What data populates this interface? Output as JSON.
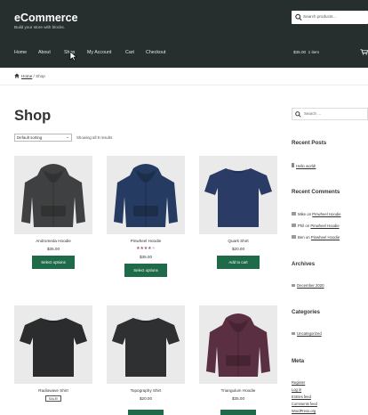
{
  "header": {
    "site_title": "eCommerce",
    "tagline": "Build your store with blocks.",
    "search_placeholder": "Search products…"
  },
  "nav": {
    "items": [
      {
        "label": "Home",
        "active": false
      },
      {
        "label": "About",
        "active": false
      },
      {
        "label": "Shop",
        "active": true
      },
      {
        "label": "My Account",
        "active": false
      },
      {
        "label": "Cart",
        "active": false
      },
      {
        "label": "Checkout",
        "active": false
      }
    ],
    "cart_total": "$35.00",
    "cart_count": "1 item"
  },
  "breadcrumb": {
    "home": "Home",
    "separator": "/",
    "current": "Shop"
  },
  "shop": {
    "title": "Shop",
    "sorting_value": "Default sorting",
    "results": "Showing all 9 results"
  },
  "products": [
    {
      "name": "Andromeda Hoodie",
      "price": "$35.00",
      "button": "Select options",
      "rating": null,
      "sale": false,
      "color": "#3f4041",
      "kind": "hoodie"
    },
    {
      "name": "Pinwheel Hoodie",
      "price": "$35.00",
      "button": "Select options",
      "rating": 4,
      "sale": false,
      "color": "#263b61",
      "kind": "hoodie"
    },
    {
      "name": "Quark Shirt",
      "price": "$20.00",
      "button": "Add to cart",
      "rating": null,
      "sale": false,
      "color": "#2a3b66",
      "kind": "shirt"
    },
    {
      "name": "Radiowave Shirt",
      "price": "$20.00",
      "button": "",
      "rating": null,
      "sale": true,
      "sale_label": "SALE!",
      "color": "#2b2c2d",
      "kind": "shirt"
    },
    {
      "name": "Topography Shirt",
      "price": "$20.00",
      "button": "",
      "rating": null,
      "sale": false,
      "color": "#2f3031",
      "kind": "shirt"
    },
    {
      "name": "Triangulum Hoodie",
      "price": "$35.00",
      "button": "",
      "rating": null,
      "sale": false,
      "color": "#5a2f41",
      "kind": "hoodie"
    }
  ],
  "sidebar": {
    "search_placeholder": "Search …",
    "recent_posts_title": "Recent Posts",
    "recent_posts": [
      "Hello world!"
    ],
    "recent_comments_title": "Recent Comments",
    "recent_comments": [
      {
        "author": "Mike",
        "on": "on",
        "post": "Pinwheel Hoodie"
      },
      {
        "author": "Phil",
        "on": "on",
        "post": "Pinwheel Hoodie"
      },
      {
        "author": "Ben",
        "on": "on",
        "post": "Pinwheel Hoodie"
      }
    ],
    "archives_title": "Archives",
    "archives": [
      "December 2020"
    ],
    "categories_title": "Categories",
    "categories": [
      "Uncategorized"
    ],
    "meta_title": "Meta",
    "meta": [
      "Register",
      "Log in",
      "Entries feed",
      "Comments feed",
      "WordPress.org"
    ]
  },
  "colors": {
    "header_bg": "#262f2d",
    "button_green": "#1f6b49",
    "star": "#96588a"
  }
}
